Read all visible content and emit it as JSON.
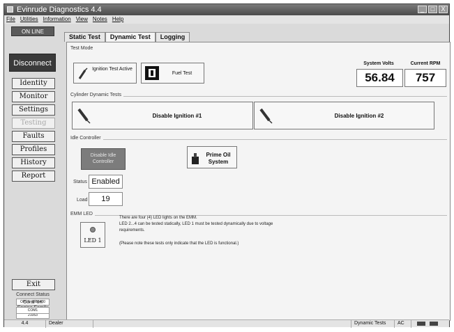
{
  "window": {
    "title": "Evinrude Diagnostics 4.4",
    "controls": [
      "_",
      "□",
      "X"
    ]
  },
  "menu": {
    "items": [
      "File",
      "Utilities",
      "Information",
      "View",
      "Notes",
      "Help"
    ]
  },
  "sidebar": {
    "status": "ON LINE",
    "disconnect": "Disconnect",
    "nav": [
      {
        "label": "Identity",
        "enabled": true
      },
      {
        "label": "Monitor",
        "enabled": true
      },
      {
        "label": "Settings",
        "enabled": true
      },
      {
        "label": "Testing",
        "enabled": false
      },
      {
        "label": "Faults",
        "enabled": true
      },
      {
        "label": "Profiles",
        "enabled": true
      },
      {
        "label": "History",
        "enabled": true
      },
      {
        "label": "Report",
        "enabled": true
      }
    ],
    "exit": "Exit",
    "connect_status_label": "Connect Status",
    "connect_status_value": "OPEN @ 38400",
    "engine_family_label": "Engine Family",
    "engine_family_value": "21053",
    "comport_label": "ComPort",
    "comport_value": "COM1"
  },
  "tabs": [
    {
      "label": "Static Test",
      "active": false
    },
    {
      "label": "Dynamic Test",
      "active": true
    },
    {
      "label": "Logging",
      "active": false
    }
  ],
  "test_mode": {
    "group_label": "Test Mode",
    "ignition_label": "Ignition Test Active",
    "fuel_label": "Fuel Test"
  },
  "readouts": {
    "volts_label": "System Volts",
    "volts_value": "56.84",
    "rpm_label": "Current RPM",
    "rpm_value": "757"
  },
  "cylinder": {
    "group_label": "Cylinder Dynamic Tests",
    "cyl1": "Disable Ignition #1",
    "cyl2": "Disable Ignition #2"
  },
  "idle": {
    "group_label": "Idle Controller",
    "disable_label": "Disable Idle Controller",
    "prime_label": "Prime Oil System",
    "status_label": "Status",
    "status_value": "Enabled",
    "load_label": "Load",
    "load_value": "19"
  },
  "emm": {
    "group_label": "EMM LED",
    "led_label": "LED 1",
    "line1": "There are four (4) LED lights on the EMM.",
    "line2": "LED 2...4 can be tested statically, LED 1 must be tested dynamically due to voltage",
    "line3": "requirements.",
    "line4": "(Please note these tests only indicate that the LED is functional.)"
  },
  "statusbar": {
    "version": "4.4",
    "role": "Dealer",
    "mode": "Dynamic Tests",
    "power": "AC"
  }
}
